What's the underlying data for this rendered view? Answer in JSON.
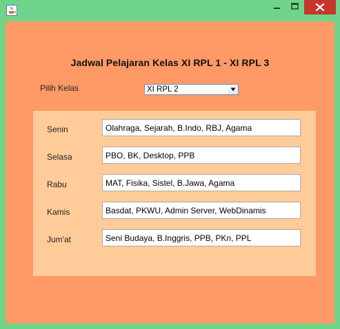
{
  "window": {
    "icon": "java-cup-icon",
    "controls": {
      "minimize_icon": "minimize-icon",
      "maximize_icon": "maximize-icon",
      "close_icon": "close-icon",
      "close_color": "#c7352b"
    },
    "frame_color": "#6fd48a"
  },
  "colors": {
    "background": "#ff9966",
    "panel": "#ffcc99"
  },
  "main": {
    "title": "Jadwal Pelajaran Kelas XI RPL 1 - XI RPL 3",
    "class_selector": {
      "label": "Pilih Kelas",
      "selected": "XI RPL 2"
    },
    "schedule": [
      {
        "day": "Senin",
        "subjects": "Olahraga, Sejarah, B.Indo, RBJ, Agama"
      },
      {
        "day": "Selasa",
        "subjects": "PBO, BK, Desktop, PPB"
      },
      {
        "day": "Rabu",
        "subjects": "MAT, Fisika, Sistel, B.Jawa, Agama"
      },
      {
        "day": "Kamis",
        "subjects": "Basdat, PKWU, Admin Server, WebDinamis"
      },
      {
        "day": "Jum'at",
        "subjects": "Seni Budaya, B.Inggris, PPB, PKn, PPL"
      }
    ]
  }
}
